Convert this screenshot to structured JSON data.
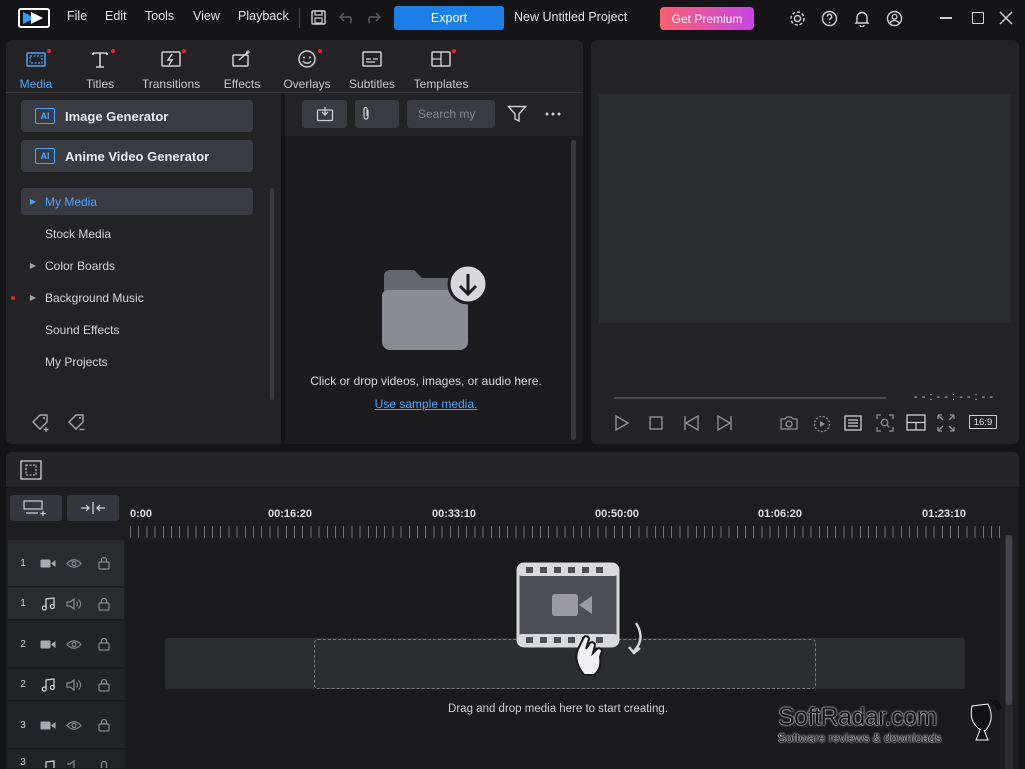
{
  "menu": {
    "file": "File",
    "edit": "Edit",
    "tools": "Tools",
    "view": "View",
    "playback": "Playback",
    "export": "Export",
    "project_title": "New Untitled Project",
    "get_premium": "Get Premium"
  },
  "tabs": [
    {
      "label": "Media",
      "active": true
    },
    {
      "label": "Titles"
    },
    {
      "label": "Transitions"
    },
    {
      "label": "Effects"
    },
    {
      "label": "Overlays"
    },
    {
      "label": "Subtitles"
    },
    {
      "label": "Templates"
    }
  ],
  "generators": {
    "ai_badge": "AI",
    "image": "Image Generator",
    "anime": "Anime Video Generator"
  },
  "library": {
    "items": [
      {
        "label": "My Media",
        "selected": true
      },
      {
        "label": "Stock Media"
      },
      {
        "label": "Color Boards"
      },
      {
        "label": "Background Music"
      },
      {
        "label": "Sound Effects"
      },
      {
        "label": "My Projects"
      }
    ]
  },
  "media_panel": {
    "search_placeholder": "Search my",
    "drop_text": "Click or drop videos, images, or audio here.",
    "sample_link": "Use sample media."
  },
  "preview": {
    "timecode": "- - : - - : - - : - -",
    "aspect_ratio": "16:9"
  },
  "timeline": {
    "ticks": [
      "0:00",
      "00:16:20",
      "00:33:10",
      "00:50:00",
      "01:06:20",
      "01:23:10"
    ],
    "tracks": [
      {
        "num": "1",
        "type": "video"
      },
      {
        "num": "1",
        "type": "audio"
      },
      {
        "num": "2",
        "type": "video"
      },
      {
        "num": "2",
        "type": "audio"
      },
      {
        "num": "3",
        "type": "video"
      },
      {
        "num": "3",
        "type": "audio"
      }
    ],
    "drop_hint": "Drag and drop media here to start creating."
  },
  "watermark": {
    "brand": "SoftRadar.com",
    "tagline": "Software reviews & downloads"
  },
  "colors": {
    "accent": "#1e7ee8",
    "active_tab": "#4aa3ff",
    "notification_dot": "#e8262e",
    "panel": "#232326",
    "background": "#151518"
  }
}
